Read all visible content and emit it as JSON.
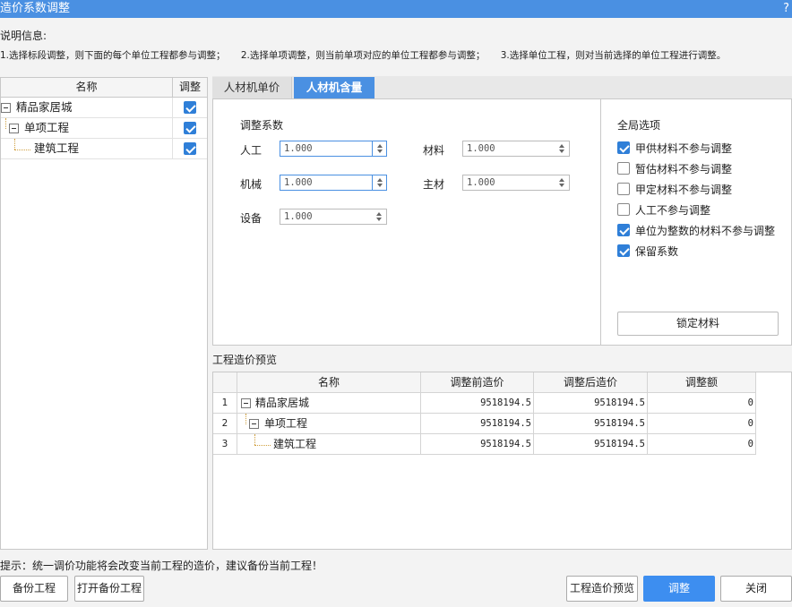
{
  "window": {
    "title": "造价系数调整",
    "help": "?"
  },
  "description": {
    "label": "说明信息:",
    "items": [
      "1.选择标段调整，则下面的每个单位工程都参与调整；",
      "2.选择单项调整，则当前单项对应的单位工程都参与调整；",
      "3.选择单位工程，则对当前选择的单位工程进行调整。"
    ]
  },
  "tree": {
    "headers": {
      "name": "名称",
      "adjust": "调整"
    },
    "rows": [
      {
        "name": "精品家居城",
        "checked": true
      },
      {
        "name": "单项工程",
        "checked": true
      },
      {
        "name": "建筑工程",
        "checked": true
      }
    ]
  },
  "tabs": [
    {
      "label": "人材机单价",
      "active": false
    },
    {
      "label": "人材机含量",
      "active": true
    }
  ],
  "coefficients": {
    "title": "调整系数",
    "labor": {
      "label": "人工",
      "value": "1.000"
    },
    "material": {
      "label": "材料",
      "value": "1.000"
    },
    "machine": {
      "label": "机械",
      "value": "1.000"
    },
    "main_material": {
      "label": "主材",
      "value": "1.000"
    },
    "equipment": {
      "label": "设备",
      "value": "1.000"
    }
  },
  "global_options": {
    "title": "全局选项",
    "items": [
      {
        "label": "甲供材料不参与调整",
        "checked": true
      },
      {
        "label": "暂估材料不参与调整",
        "checked": false
      },
      {
        "label": "甲定材料不参与调整",
        "checked": false
      },
      {
        "label": "人工不参与调整",
        "checked": false
      },
      {
        "label": "单位为整数的材料不参与调整",
        "checked": true
      },
      {
        "label": "保留系数",
        "checked": true
      }
    ],
    "lock_button": "锁定材料"
  },
  "preview": {
    "label": "工程造价预览",
    "headers": {
      "name": "名称",
      "before": "调整前造价",
      "after": "调整后造价",
      "diff": "调整额"
    },
    "rows": [
      {
        "index": "1",
        "name": "精品家居城",
        "before": "9518194.5",
        "after": "9518194.5",
        "diff": "0"
      },
      {
        "index": "2",
        "name": "单项工程",
        "before": "9518194.5",
        "after": "9518194.5",
        "diff": "0"
      },
      {
        "index": "3",
        "name": "建筑工程",
        "before": "9518194.5",
        "after": "9518194.5",
        "diff": "0"
      }
    ]
  },
  "tip": "提示：统一调价功能将会改变当前工程的造价，建议备份当前工程！",
  "buttons": {
    "backup": "备份工程",
    "open_backup": "打开备份工程",
    "preview": "工程造价预览",
    "adjust": "调整",
    "close": "关闭"
  },
  "colors": {
    "accent": "#4a90e2",
    "primary_button": "#3d8ef0",
    "checkbox": "#2f7fd8"
  }
}
